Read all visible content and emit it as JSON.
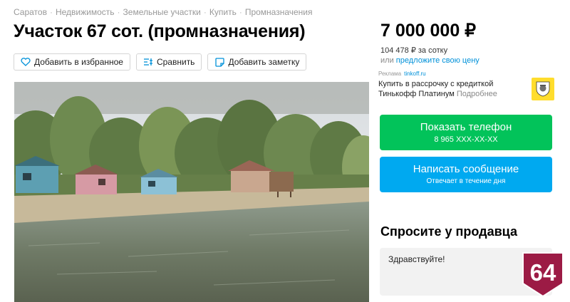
{
  "breadcrumbs": [
    "Саратов",
    "Недвижимость",
    "Земельные участки",
    "Купить",
    "Промназначения"
  ],
  "title": "Участок 67 сот. (промназначения)",
  "actions": {
    "favorite": "Добавить в избранное",
    "compare": "Сравнить",
    "note": "Добавить заметку"
  },
  "price": {
    "value": "7 000 000 ₽",
    "per_unit": "104 478 ₽ за сотку",
    "offer_prefix": "или",
    "offer_link": "предложите свою цену"
  },
  "ad": {
    "label": "Реклама",
    "domain": "tinkoff.ru",
    "text": "Купить в рассрочку с кредиткой Тинькофф Платинум",
    "more": "Подробнее"
  },
  "contact": {
    "phone_label": "Показать телефон",
    "phone_number": "8 965 XXX-XX-XX",
    "message_label": "Написать сообщение",
    "message_sub": "Отвечает в течение дня"
  },
  "ask": {
    "title": "Спросите у продавца",
    "input_value": "Здравствуйте!"
  },
  "badge": {
    "text": "64"
  },
  "colors": {
    "green_button": "#02c35a",
    "blue_button": "#00a9f0",
    "link": "#0091d9",
    "badge": "#9c1b45"
  }
}
